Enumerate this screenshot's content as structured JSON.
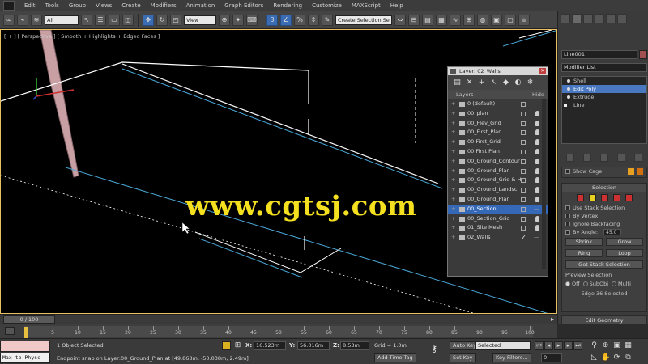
{
  "menu": [
    "Edit",
    "Tools",
    "Group",
    "Views",
    "Create",
    "Modifiers",
    "Animation",
    "Graph Editors",
    "Rendering",
    "Customize",
    "MAXScript",
    "Help"
  ],
  "toolbar": {
    "filter_value": "All",
    "refcoord_value": "View",
    "selection_set_value": "Create Selection Se"
  },
  "viewport": {
    "label": "[ + ] [ Perspective ] [ Smooth + Highlights + Edged Faces ]",
    "watermark": "www.cgtsj.com"
  },
  "layer_manager": {
    "title": "Layer: 02_Walls",
    "col_layers": "Layers",
    "col_hide": "Hide",
    "layers": [
      {
        "name": "0 (default)",
        "hide": "dash"
      },
      {
        "name": "00_plan",
        "hide": "bulb"
      },
      {
        "name": "00_Flev_Grid",
        "hide": "bulb"
      },
      {
        "name": "00_First_Plan",
        "hide": "bulb"
      },
      {
        "name": "00 First_Grid",
        "hide": "bulb"
      },
      {
        "name": "00 First Plan",
        "hide": "bulb"
      },
      {
        "name": "00_Ground_Contour",
        "hide": "bulb"
      },
      {
        "name": "00_Ground_Plan",
        "hide": "bulb"
      },
      {
        "name": "00_Ground_Grid & Hi",
        "hide": "bulb"
      },
      {
        "name": "00_Ground_Landsc",
        "hide": "bulb"
      },
      {
        "name": "00_Ground_Plan",
        "hide": "bulb"
      },
      {
        "name": "00_Section",
        "hide": "dash",
        "selected": true
      },
      {
        "name": "00_Section_Grid",
        "hide": "bulb"
      },
      {
        "name": "01_Site Mesh",
        "hide": "bulb"
      },
      {
        "name": "02_Walls",
        "hide": "dash",
        "active": true
      }
    ]
  },
  "command_panel": {
    "object_name": "Line001",
    "modifier_list": "Modifier List",
    "stack": [
      {
        "label": "Shell",
        "type": "sub"
      },
      {
        "label": "Edit Poly",
        "type": "sub",
        "selected": true
      },
      {
        "label": "Extrude",
        "type": "sub"
      },
      {
        "label": "Line",
        "type": "root"
      }
    ],
    "show_cage": "Show Cage",
    "selection_title": "Selection",
    "use_stack_selection": "Use Stack Selection",
    "by_vertex": "By Vertex",
    "ignore_backfacing": "Ignore Backfacing",
    "by_angle": "By Angle:",
    "by_angle_value": "45.0",
    "shrink": "Shrink",
    "grow": "Grow",
    "ring": "Ring",
    "loop": "Loop",
    "get_stack_selection": "Get Stack Selection",
    "preview_selection": "Preview Selection",
    "radio_off": "Off",
    "radio_subobj": "SubObj",
    "radio_multi": "Multi",
    "selected_count": "Edge 36 Selected",
    "edit_geometry": "Edit Geometry"
  },
  "timeslider": {
    "value": "0 / 100",
    "ticks": [
      "5",
      "10",
      "15",
      "20",
      "25",
      "30",
      "35",
      "40",
      "45",
      "50",
      "55",
      "60",
      "65",
      "70",
      "75",
      "80",
      "85",
      "90",
      "95",
      "100"
    ]
  },
  "status": {
    "maxscript_text": "Max to Physc",
    "objects_selected": "1 Object Selected",
    "prompt": "Endpoint snap on Layer:00_Ground_Plan at [49.863m, -50.038m, 2.49m]",
    "x_label": "X:",
    "x_value": "16.523m",
    "y_label": "Y:",
    "y_value": "56.016m",
    "z_label": "Z:",
    "z_value": "8.53m",
    "grid": "Grid = 1.0m",
    "auto_key": "Auto Key",
    "selected_mode": "Selected",
    "set_key": "Set Key",
    "key_filters": "Key Filters...",
    "add_time_tag": "Add Time Tag",
    "frame": "0"
  }
}
